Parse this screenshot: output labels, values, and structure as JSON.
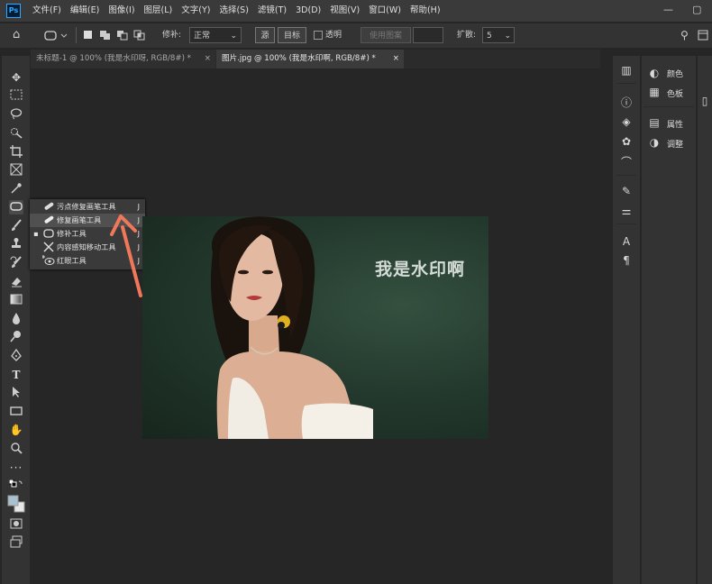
{
  "app": {
    "logo": "Ps"
  },
  "menu": [
    "文件(F)",
    "编辑(E)",
    "图像(I)",
    "图层(L)",
    "文字(Y)",
    "选择(S)",
    "滤镜(T)",
    "3D(D)",
    "视图(V)",
    "窗口(W)",
    "帮助(H)"
  ],
  "window_controls": {
    "minimize": "—",
    "maximize": "▢"
  },
  "options": {
    "patch_label": "修补:",
    "patch_mode": "正常",
    "source_btn": "源",
    "target_btn": "目标",
    "transparent_label": "透明",
    "use_pattern_btn": "使用图案",
    "diffusion_label": "扩散:",
    "diffusion_value": "5"
  },
  "tabs": [
    {
      "title": "未标题-1 @ 100% (我是水印呀, RGB/8#) *",
      "close": "×"
    },
    {
      "title": "图片.jpg @ 100% (我是水印啊, RGB/8#) *",
      "close": "×"
    }
  ],
  "flyout": [
    {
      "label": "污点修复画笔工具",
      "shortcut": "J",
      "icon": "spot-healing-icon"
    },
    {
      "label": "修复画笔工具",
      "shortcut": "J",
      "icon": "healing-brush-icon"
    },
    {
      "label": "修补工具",
      "shortcut": "J",
      "icon": "patch-icon"
    },
    {
      "label": "内容感知移动工具",
      "shortcut": "J",
      "icon": "content-aware-move-icon"
    },
    {
      "label": "红眼工具",
      "shortcut": "J",
      "icon": "red-eye-icon"
    }
  ],
  "watermark": "我是水印啊",
  "panels": {
    "color": "颜色",
    "swatches": "色板",
    "properties": "属性",
    "adjustments": "调整"
  },
  "colors": {
    "accent_arrow": "#f0785a",
    "app_bg": "#262626",
    "panel_bg": "#333333"
  }
}
